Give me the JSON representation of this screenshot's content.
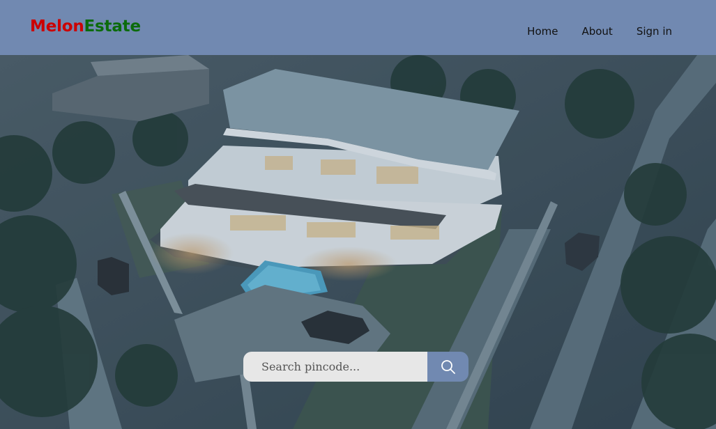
{
  "brand": {
    "part1": "Melon",
    "part2": "Estate",
    "color1": "#cc0000",
    "color2": "#0b6b0b"
  },
  "header": {
    "background": "#7189b1"
  },
  "nav": {
    "items": [
      {
        "label": "Home"
      },
      {
        "label": "About"
      },
      {
        "label": "Sign in"
      }
    ]
  },
  "hero": {
    "description_icon": "aerial-villa-photo"
  },
  "search": {
    "placeholder": "Search pincode...",
    "value": "",
    "button_icon": "search-icon"
  }
}
